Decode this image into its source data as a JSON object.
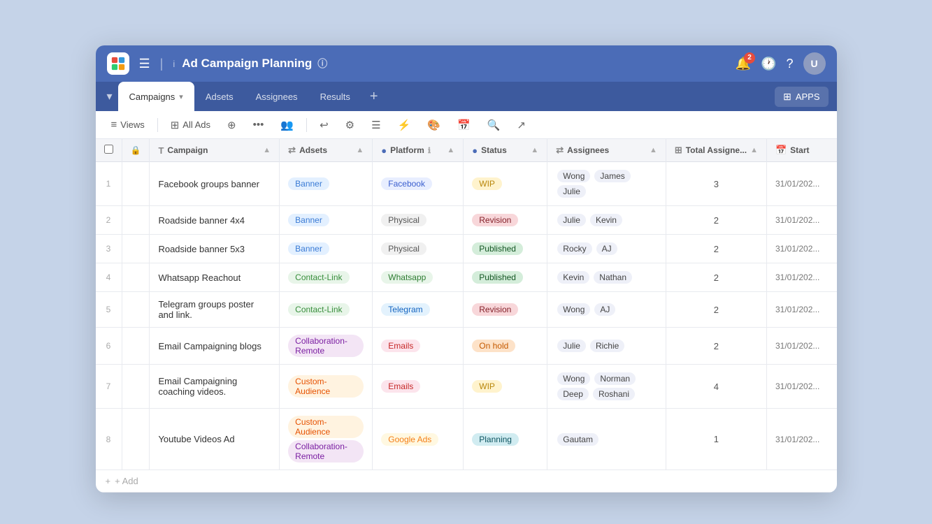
{
  "header": {
    "title": "Ad Campaign Planning",
    "menu_label": "☰",
    "info_label": "ℹ",
    "notification_count": "2",
    "avatar_initials": "U"
  },
  "tabs": {
    "dropdown_icon": "▾",
    "items": [
      {
        "id": "campaigns",
        "label": "Campaigns",
        "active": true
      },
      {
        "id": "adsets",
        "label": "Adsets",
        "active": false
      },
      {
        "id": "assignees",
        "label": "Assignees",
        "active": false
      },
      {
        "id": "results",
        "label": "Results",
        "active": false
      }
    ],
    "add_icon": "+",
    "apps_label": "APPS"
  },
  "toolbar": {
    "views_label": "Views",
    "all_ads_label": "All Ads"
  },
  "table": {
    "columns": [
      {
        "id": "num",
        "label": "#",
        "icon": ""
      },
      {
        "id": "lock",
        "label": "",
        "icon": "🔒"
      },
      {
        "id": "campaign",
        "label": "Campaign",
        "icon": "T"
      },
      {
        "id": "adsets",
        "label": "Adsets",
        "icon": "⇄"
      },
      {
        "id": "platform",
        "label": "Platform",
        "icon": "●",
        "info": true
      },
      {
        "id": "status",
        "label": "Status",
        "icon": "●"
      },
      {
        "id": "assignees",
        "label": "Assignees",
        "icon": "⇄"
      },
      {
        "id": "total",
        "label": "Total Assigne...",
        "icon": "⊞"
      },
      {
        "id": "start",
        "label": "Start",
        "icon": "📅"
      }
    ],
    "rows": [
      {
        "num": "1",
        "campaign": "Facebook groups banner",
        "adset": "Banner",
        "adset_type": "banner",
        "platform": "Facebook",
        "platform_type": "facebook",
        "status": "WIP",
        "status_type": "wip",
        "assignees": [
          "Wong",
          "James",
          "Julie"
        ],
        "total": "3",
        "start": "31/01/202..."
      },
      {
        "num": "2",
        "campaign": "Roadside banner 4x4",
        "adset": "Banner",
        "adset_type": "banner",
        "platform": "Physical",
        "platform_type": "physical",
        "status": "Revision",
        "status_type": "revision",
        "assignees": [
          "Julie",
          "Kevin"
        ],
        "total": "2",
        "start": "31/01/202..."
      },
      {
        "num": "3",
        "campaign": "Roadside banner 5x3",
        "adset": "Banner",
        "adset_type": "banner",
        "platform": "Physical",
        "platform_type": "physical",
        "status": "Published",
        "status_type": "published",
        "assignees": [
          "Rocky",
          "AJ"
        ],
        "total": "2",
        "start": "31/01/202..."
      },
      {
        "num": "4",
        "campaign": "Whatsapp Reachout",
        "adset": "Contact-Link",
        "adset_type": "contact",
        "platform": "Whatsapp",
        "platform_type": "whatsapp",
        "status": "Published",
        "status_type": "published",
        "assignees": [
          "Kevin",
          "Nathan"
        ],
        "total": "2",
        "start": "31/01/202..."
      },
      {
        "num": "5",
        "campaign": "Telegram groups poster and link.",
        "adset": "Contact-Link",
        "adset_type": "contact",
        "platform": "Telegram",
        "platform_type": "telegram",
        "status": "Revision",
        "status_type": "revision",
        "assignees": [
          "Wong",
          "AJ"
        ],
        "total": "2",
        "start": "31/01/202..."
      },
      {
        "num": "6",
        "campaign": "Email Campaigning blogs",
        "adset": "Collaboration-Remote",
        "adset_type": "collab",
        "platform": "Emails",
        "platform_type": "emails",
        "status": "On hold",
        "status_type": "onhold",
        "assignees": [
          "Julie",
          "Richie"
        ],
        "total": "2",
        "start": "31/01/202..."
      },
      {
        "num": "7",
        "campaign": "Email Campaigning coaching videos.",
        "adset": "Custom-Audience",
        "adset_type": "custom",
        "platform": "Emails",
        "platform_type": "emails",
        "status": "WIP",
        "status_type": "wip",
        "assignees": [
          "Wong",
          "Norman",
          "Deep",
          "Roshani"
        ],
        "total": "4",
        "start": "31/01/202..."
      },
      {
        "num": "8",
        "campaign": "Youtube Videos Ad",
        "adset": "Custom-Audience",
        "adset_type": "custom",
        "adset2": "Collaboration-Remote",
        "adset2_type": "collab",
        "platform": "Google Ads",
        "platform_type": "google",
        "status": "Planning",
        "status_type": "planning",
        "assignees": [
          "Gautam"
        ],
        "total": "1",
        "start": "31/01/202..."
      }
    ],
    "add_row_label": "+ Add"
  }
}
